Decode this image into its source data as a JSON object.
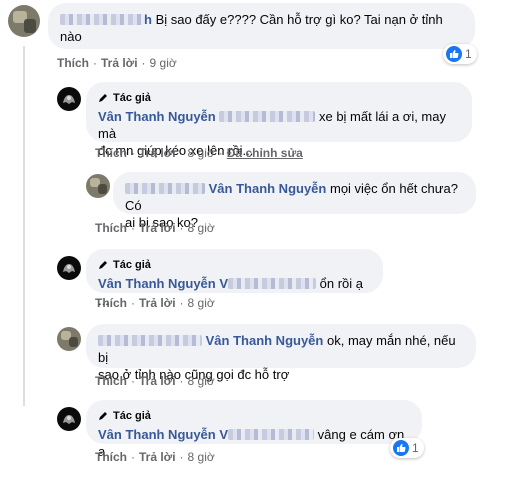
{
  "comments": [
    {
      "id": "c1",
      "author_visible": "h",
      "text": "Bị sao đấy e???? Cần hỗ trợ gì ko? Tai nạn ở tỉnh",
      "text2": "nào",
      "actions": {
        "like": "Thích",
        "reply": "Trả lời",
        "time": "9 giờ"
      },
      "reaction_count": "1"
    },
    {
      "id": "c2",
      "tag": "Tác giả",
      "author": "Vân Thanh Nguyễn",
      "text": "xe bị mất lái a ơi, may mà",
      "text2": "đc mn giúp kéo xe lên rồi...",
      "actions": {
        "like": "Thích",
        "reply": "Trả lời",
        "time": "8 giờ",
        "edited": "Đã chỉnh sửa"
      }
    },
    {
      "id": "c3",
      "mention": "Vân Thanh Nguyễn",
      "text": "mọi việc ổn hết chưa? Có",
      "text2": "ai bị sao ko?",
      "actions": {
        "like": "Thích",
        "reply": "Trả lời",
        "time": "8 giờ"
      }
    },
    {
      "id": "c4",
      "tag": "Tác giả",
      "author": "Vân Thanh Nguyễn",
      "author_suffix": "V",
      "text": "ổn rồi ạ ...",
      "actions": {
        "like": "Thích",
        "reply": "Trả lời",
        "time": "8 giờ"
      }
    },
    {
      "id": "c5",
      "mention": "Vân Thanh Nguyễn",
      "text": "ok, may mắn nhé, nếu bị",
      "text2": "sao ở tỉnh nào cũng gọi đc hỗ trợ",
      "actions": {
        "like": "Thích",
        "reply": "Trả lời",
        "time": "8 giờ"
      }
    },
    {
      "id": "c6",
      "tag": "Tác giả",
      "author": "Vân Thanh Nguyễn",
      "author_suffix": "V",
      "text": "vâng e cám ơn a",
      "actions": {
        "like": "Thích",
        "reply": "Trả lời",
        "time": "8 giờ"
      },
      "reaction_count": "1"
    }
  ],
  "colors": {
    "link": "#385898",
    "meta": "#65676b",
    "bubble": "#f0f2f5",
    "like": "#1877f2"
  },
  "icons": {
    "like": "thumbs-up-icon",
    "author_tag": "pen-icon"
  }
}
